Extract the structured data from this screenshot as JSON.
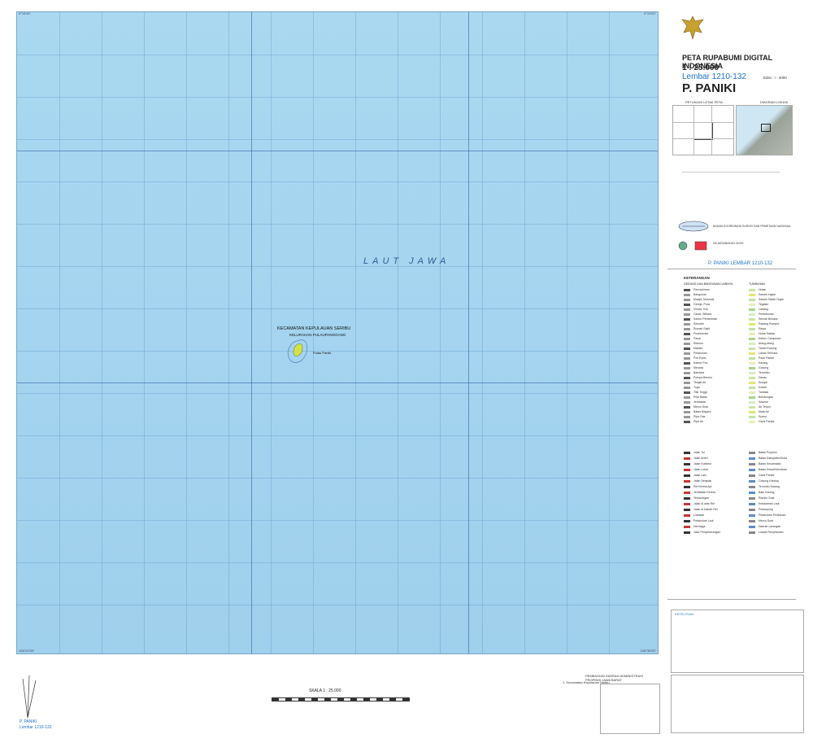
{
  "map": {
    "sea_label": "LAUT JAWA",
    "district_label": "KECAMATAN KEPULAUAN SERIBU",
    "village_label": "KELURAHAN PULAUPANGGANG",
    "island_label": "Pulau Paniki",
    "corner_top_left": "0°19'00\"",
    "corner_top_right": "0°19'00\"",
    "corner_bottom_left": "106°22'30\"",
    "corner_bottom_right": "106°30'00\""
  },
  "header": {
    "title": "PETA RUPABUMI DIGITAL INDONESIA",
    "scale": "1 : 25.000",
    "sheet": "Lembar 1210-132",
    "edition": "Edisi : I - 2000",
    "name": "P. PANIKI",
    "index_label": "PETUNJUK LETAK PETA",
    "diagram_label": "DIAGRAM LOKASI"
  },
  "info": {
    "sheet_footer": "P. PANIKI LEMBAR 1210-132",
    "legend_title": "KETERANGAN",
    "legend_col1_title": "GEDUNG DAN BANGUNAN LAINNYA",
    "legend_col2_title": "TUMBUHAN",
    "publisher": "BADAN KOORDINASI SURVEI DAN PEMETAAN NASIONAL",
    "partner": "DILAKSANAKAN OLEH"
  },
  "footer": {
    "scale_label": "SKALA 1 : 25.000",
    "sheet_small": "P. PANIKI",
    "sheet_num_small": "Lembar 1210-132",
    "reliability": "KETELITIAN",
    "province_title": "PEMBAGIAN DAERAH ADMINISTRASI PROPINSI JAWA BARAT",
    "province_item": "1. Kecamatan Kepulauan Seribu"
  },
  "legend": {
    "col1": [
      "Permukiman",
      "Bangunan",
      "Masjid, Mushola",
      "Gereja, Pura",
      "Vihara, Kuil",
      "Candi, Wihara",
      "Kantor Pemerintah",
      "Sekolah",
      "Rumah Sakit",
      "Puskesmas",
      "Pasar",
      "Stasiun",
      "Makam",
      "Pelabuhan",
      "Pos Polisi",
      "Kantor Pos",
      "Menara",
      "Bandara",
      "Pompa Bensin",
      "Tangki Air",
      "Tugu",
      "Titik Tinggi",
      "Pilar Batas",
      "Jembatan",
      "Mercu Suar",
      "Batas Negara",
      "Pipa Gas",
      "Pipa Air"
    ],
    "col2": [
      "Hutan",
      "Sawah Irigasi",
      "Sawah Tadah Hujan",
      "Tegalan",
      "Ladang",
      "Perkebunan",
      "Semak Belukar",
      "Padang Rumput",
      "Rawa",
      "Hutan Bakau",
      "Kebun Campuran",
      "Alang-alang",
      "Tanah Kosong",
      "Lahan Terbuka",
      "Pasir Pantai",
      "Karang",
      "Gosong",
      "Terumbu",
      "Danau",
      "Sungai",
      "Kolam",
      "Tambak",
      "Bendungan",
      "Saluran",
      "Air Terjun",
      "Mata Air",
      "Sumur",
      "Garis Pantai"
    ],
    "col1b": [
      "Jalan Tol",
      "Jalan Arteri",
      "Jalan Kolektor",
      "Jalan Lokal",
      "Jalan Lain",
      "Jalan Setapak",
      "Rel Kereta Api",
      "Jembatan Kereta",
      "Terowongan",
      "Jalan di atas Rel",
      "Jalan di bawah Rel",
      "Lintasan",
      "Pelabuhan Laut",
      "Dermaga",
      "Jalur Penyeberangan"
    ],
    "col2b": [
      "Batas Propinsi",
      "Batas Kabupaten/Kota",
      "Batas Kecamatan",
      "Batas Desa/Kelurahan",
      "Garis Pantai",
      "Gosong Karang",
      "Terumbu Karang",
      "Batu Karang",
      "Rambu Suar",
      "Kedalaman Laut",
      "Pelampung",
      "Pelabuhan Perikanan",
      "Mercu Suar",
      "Daerah Larangan",
      "Lokasi Penyelaman"
    ]
  },
  "colors": {
    "sea": "#a4d4ef",
    "title_blue": "#1a73c8",
    "island": "#e5e85a",
    "frame": "#7aa6c8"
  }
}
